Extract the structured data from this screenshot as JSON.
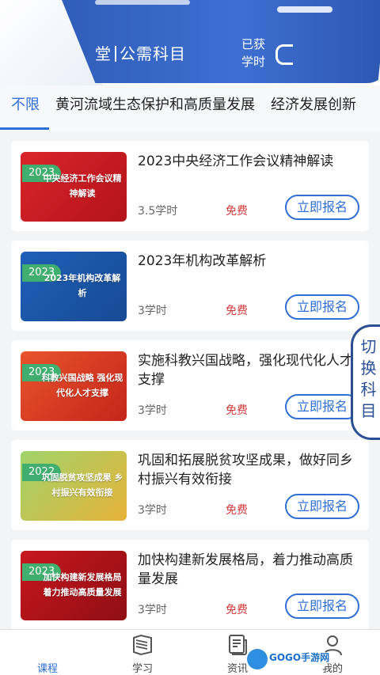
{
  "banner": {
    "title_left": "堂",
    "title_right": "公需科目",
    "learned_label": "已获学时"
  },
  "tabs": [
    {
      "label": "不限",
      "active": true
    },
    {
      "label": "黄河流域生态保护和高质量发展",
      "active": false
    },
    {
      "label": "经济发展创新",
      "active": false
    }
  ],
  "courses": [
    {
      "year": "2023",
      "thumb_text": "中央经济工作会议精神解读",
      "title": "2023中央经济工作会议精神解读",
      "hours": "3.5学时",
      "price": "免费",
      "button": "立即报名",
      "thumb_colors": [
        "#d9252b",
        "#b3131a"
      ]
    },
    {
      "year": "2023",
      "thumb_text": "2023年机构改革解析",
      "title": "2023年机构改革解析",
      "hours": "3学时",
      "price": "免费",
      "button": "立即报名",
      "thumb_colors": [
        "#1f5fb8",
        "#174a93"
      ]
    },
    {
      "year": "2023",
      "thumb_text": "科教兴国战略 强化现代化人才支撑",
      "title": "实施科教兴国战略，强化现代化人才支撑",
      "hours": "3学时",
      "price": "免费",
      "button": "立即报名",
      "thumb_colors": [
        "#e8542d",
        "#c4251a"
      ]
    },
    {
      "year": "2022",
      "thumb_text": "巩固脱贫攻坚成果 乡村振兴有效衔接",
      "title": "巩固和拓展脱贫攻坚成果，做好同乡村振兴有效衔接",
      "hours": "3学时",
      "price": "免费",
      "button": "立即报名",
      "thumb_colors": [
        "#9fd46a",
        "#e7b23a"
      ]
    },
    {
      "year": "2023",
      "thumb_text": "加快构建新发展格局 着力推动高质量发展",
      "title": "加快构建新发展格局，着力推动高质量发展",
      "hours": "3学时",
      "price": "免费",
      "button": "立即报名",
      "thumb_colors": [
        "#c7161e",
        "#8f0f14"
      ]
    }
  ],
  "switch_subject": "切换科目",
  "nav": [
    {
      "label": "课程",
      "icon": "course-icon",
      "active": true
    },
    {
      "label": "学习",
      "icon": "book-icon",
      "active": false
    },
    {
      "label": "资讯",
      "icon": "news-icon",
      "active": false
    },
    {
      "label": "我的",
      "icon": "user-icon",
      "active": false
    }
  ],
  "watermark": "GOGO手游网",
  "colors": {
    "accent": "#2f6fd6",
    "price": "#d23b3b",
    "badge": "#3fae6e",
    "banner": "#3d6fd2"
  }
}
